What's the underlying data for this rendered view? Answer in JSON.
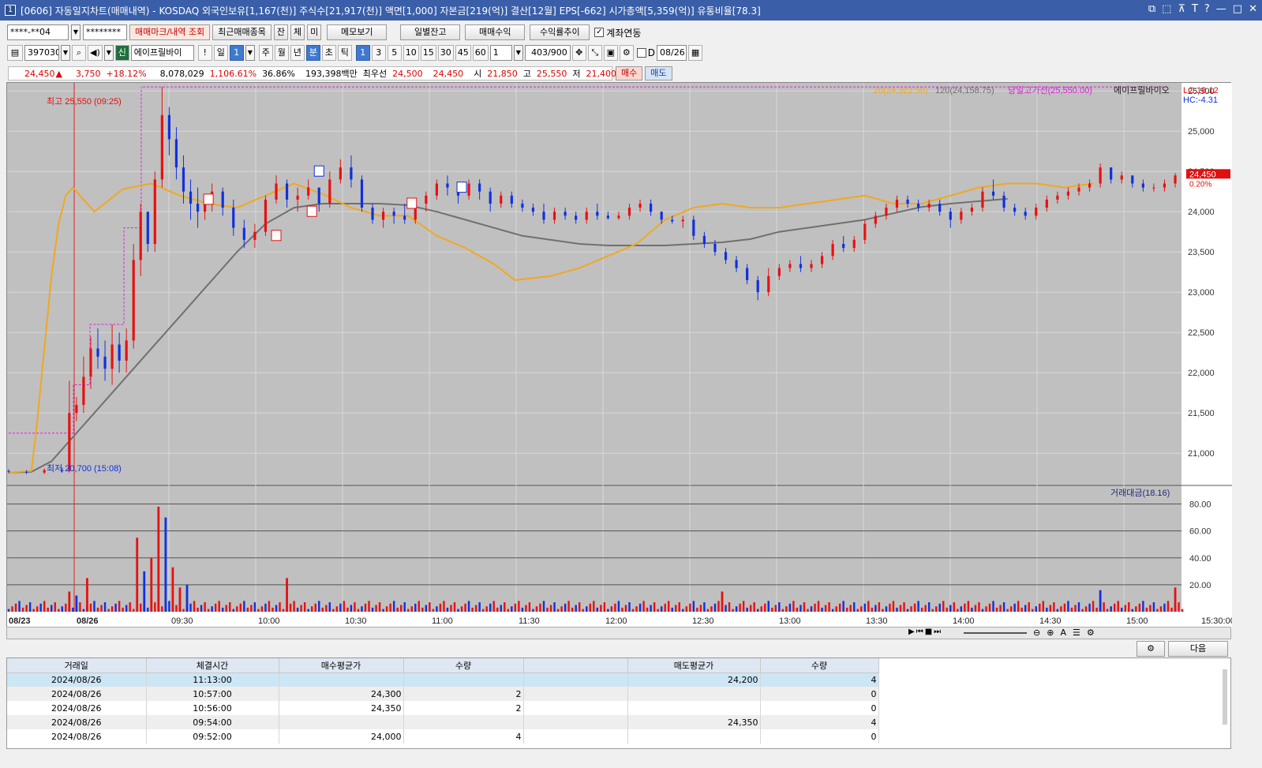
{
  "window": {
    "num": "1",
    "title": "[0606] 자동일지차트(매매내역) - KOSDAQ 외국인보유[1,167(천)] 주식수[21,917(천)] 액면[1,000] 자본금[219(억)] 결산[12월] EPS[-662] 시가총액[5,359(억)] 유통비율[78.3]",
    "controls": [
      "⧉",
      "⬚",
      "⊼",
      "T",
      "?",
      "—",
      "□",
      "✕"
    ]
  },
  "toolbar1": {
    "account": "****-**04",
    "password": "********",
    "mark_btn": "매매마크/내역 조회",
    "recent_btn": "최근매매종목",
    "tabs": [
      "잔",
      "체",
      "미"
    ],
    "memo_btn": "메모보기",
    "daily_btn": "일별잔고",
    "profit_btn": "매매수익",
    "rate_btn": "수익률추이",
    "link_label": "계좌연동",
    "link_checked": true
  },
  "toolbar2": {
    "code": "397030",
    "new_badge": "신",
    "stock_name": "에이프릴바이",
    "alert": "!",
    "period_day": "일",
    "period_num": "1",
    "periods": [
      "주",
      "월",
      "년",
      "분",
      "초",
      "틱"
    ],
    "period_selected": "분",
    "intervals": [
      "1",
      "3",
      "5",
      "10",
      "15",
      "30",
      "45",
      "60"
    ],
    "interval_selected": "1",
    "custom_interval": "1",
    "count": "403",
    "count_total": "/900",
    "d_label": "D",
    "date": "08/26"
  },
  "quote": {
    "price": "24,450",
    "arrow": "▲",
    "change": "3,750",
    "change_rate": "+18.12%",
    "volume": "8,078,029",
    "vol_rate": "1,106.61%",
    "turnover": "36.86%",
    "amount": "193,398백만",
    "best_label": "최우선",
    "ask": "24,500",
    "bid": "24,450",
    "open_label": "시",
    "open": "21,850",
    "high_label": "고",
    "high": "25,550",
    "low_label": "저",
    "low": "21,400",
    "buy_btn": "매수",
    "sell_btn": "매도"
  },
  "chart_data": {
    "type": "candlestick",
    "legend": {
      "ma20": "20(24,322.50)",
      "ma120": "120(24,158.75)",
      "highline": "당일고가선(25,550.00)",
      "name": "에이프릴바이오",
      "lc": "LC:18.12",
      "hc": "HC:-4.31"
    },
    "annotations": {
      "high": "최고 25,550 (09:25)",
      "low": "최저 20,700 (15:08)"
    },
    "current_price": "24,450",
    "current_rate": "0.20%",
    "price_ticks": [
      "25,500",
      "25,000",
      "24,500",
      "24,000",
      "23,500",
      "23,000",
      "22,500",
      "22,000",
      "21,500",
      "21,000"
    ],
    "price_tick_values": [
      25500,
      25000,
      24500,
      24000,
      23500,
      23000,
      22500,
      22000,
      21500,
      21000
    ],
    "volume_label": "거래대금(18.16)",
    "volume_ticks": [
      "80.00",
      "60.00",
      "40.00",
      "20.00"
    ],
    "volume_tick_values": [
      80,
      60,
      40,
      20
    ],
    "time_labels": [
      "08/23",
      "08/26",
      "09:30",
      "10:00",
      "10:30",
      "11:00",
      "11:30",
      "12:00",
      "12:30",
      "13:00",
      "13:30",
      "14:00",
      "14:30",
      "15:00",
      "15:30:00"
    ],
    "ma20_points": [
      [
        0,
        20760
      ],
      [
        16,
        20780
      ],
      [
        20,
        21400
      ],
      [
        25,
        22300
      ],
      [
        30,
        23200
      ],
      [
        35,
        23850
      ],
      [
        40,
        24200
      ],
      [
        45,
        24300
      ],
      [
        60,
        24000
      ],
      [
        80,
        24280
      ],
      [
        100,
        24350
      ],
      [
        120,
        24200
      ],
      [
        140,
        24100
      ],
      [
        160,
        24050
      ],
      [
        180,
        24200
      ],
      [
        200,
        24350
      ],
      [
        220,
        24220
      ],
      [
        240,
        24050
      ],
      [
        260,
        23950
      ],
      [
        280,
        23950
      ],
      [
        300,
        23700
      ],
      [
        320,
        23550
      ],
      [
        340,
        23350
      ],
      [
        355,
        23150
      ],
      [
        380,
        23200
      ],
      [
        400,
        23300
      ],
      [
        420,
        23450
      ],
      [
        440,
        23600
      ],
      [
        460,
        23900
      ],
      [
        480,
        24050
      ],
      [
        500,
        24100
      ],
      [
        520,
        24050
      ],
      [
        540,
        24050
      ],
      [
        560,
        24100
      ],
      [
        580,
        24150
      ],
      [
        600,
        24200
      ],
      [
        620,
        24100
      ],
      [
        640,
        24100
      ],
      [
        660,
        24200
      ],
      [
        680,
        24300
      ],
      [
        700,
        24350
      ],
      [
        720,
        24350
      ],
      [
        740,
        24300
      ],
      [
        760,
        24350
      ]
    ],
    "ma120_points": [
      [
        0,
        20760
      ],
      [
        16,
        20770
      ],
      [
        30,
        20900
      ],
      [
        40,
        21100
      ],
      [
        60,
        21500
      ],
      [
        80,
        21900
      ],
      [
        100,
        22300
      ],
      [
        120,
        22700
      ],
      [
        140,
        23100
      ],
      [
        160,
        23500
      ],
      [
        180,
        23850
      ],
      [
        200,
        24050
      ],
      [
        220,
        24100
      ],
      [
        240,
        24100
      ],
      [
        260,
        24100
      ],
      [
        280,
        24080
      ],
      [
        300,
        24000
      ],
      [
        320,
        23900
      ],
      [
        340,
        23800
      ],
      [
        360,
        23700
      ],
      [
        380,
        23650
      ],
      [
        400,
        23600
      ],
      [
        420,
        23580
      ],
      [
        440,
        23580
      ],
      [
        460,
        23580
      ],
      [
        480,
        23600
      ],
      [
        500,
        23620
      ],
      [
        520,
        23660
      ],
      [
        540,
        23750
      ],
      [
        560,
        23800
      ],
      [
        580,
        23850
      ],
      [
        600,
        23900
      ],
      [
        620,
        23980
      ],
      [
        640,
        24060
      ],
      [
        660,
        24100
      ],
      [
        680,
        24130
      ],
      [
        700,
        24160
      ]
    ],
    "candles": [
      [
        0,
        20780,
        20800,
        20750,
        20770
      ],
      [
        5,
        20770,
        20790,
        20740,
        20760
      ],
      [
        10,
        20760,
        20810,
        20740,
        20790
      ],
      [
        15,
        20790,
        20820,
        20760,
        20780
      ],
      [
        17,
        20780,
        21900,
        20760,
        21500
      ],
      [
        19,
        21500,
        21700,
        21400,
        21600
      ],
      [
        21,
        21600,
        22200,
        21500,
        21950
      ],
      [
        23,
        21950,
        22450,
        21800,
        22300
      ],
      [
        25,
        22300,
        22550,
        22050,
        22200
      ],
      [
        27,
        22200,
        22400,
        21900,
        22050
      ],
      [
        29,
        22050,
        22600,
        21850,
        22350
      ],
      [
        31,
        22350,
        22500,
        22000,
        22150
      ],
      [
        33,
        22150,
        22550,
        22000,
        22400
      ],
      [
        35,
        22400,
        23600,
        22300,
        23400
      ],
      [
        37,
        23400,
        24100,
        23200,
        24000
      ],
      [
        39,
        24000,
        23900,
        23500,
        23600
      ],
      [
        41,
        23600,
        24500,
        23500,
        24400
      ],
      [
        43,
        24400,
        25550,
        24300,
        25200
      ],
      [
        45,
        25200,
        25300,
        24700,
        24900
      ],
      [
        47,
        24900,
        25050,
        24400,
        24550
      ],
      [
        49,
        24550,
        24700,
        24100,
        24250
      ],
      [
        51,
        24250,
        24400,
        23900,
        24100
      ],
      [
        53,
        24100,
        24300,
        23800,
        24000
      ],
      [
        55,
        24000,
        24200,
        23900,
        24150
      ],
      [
        57,
        24150,
        24350,
        24000,
        24250
      ],
      [
        60,
        24250,
        24300,
        23950,
        24050
      ],
      [
        63,
        24050,
        24150,
        23700,
        23800
      ],
      [
        66,
        23800,
        23900,
        23550,
        23650
      ],
      [
        69,
        23650,
        23850,
        23550,
        23750
      ],
      [
        72,
        23750,
        24200,
        23700,
        24150
      ],
      [
        75,
        24150,
        24450,
        24100,
        24350
      ],
      [
        78,
        24350,
        24400,
        24050,
        24150
      ],
      [
        81,
        24150,
        24300,
        24000,
        24200
      ],
      [
        84,
        24200,
        24400,
        24150,
        24300
      ],
      [
        87,
        24300,
        24250,
        24000,
        24100
      ],
      [
        90,
        24100,
        24500,
        24050,
        24400
      ],
      [
        93,
        24400,
        24650,
        24350,
        24550
      ],
      [
        96,
        24550,
        24700,
        24300,
        24400
      ],
      [
        99,
        24400,
        24450,
        24000,
        24050
      ],
      [
        102,
        24050,
        24100,
        23850,
        23900
      ],
      [
        105,
        23900,
        24050,
        23800,
        24000
      ],
      [
        108,
        24000,
        24050,
        23850,
        23950
      ],
      [
        111,
        23950,
        24100,
        23850,
        23900
      ],
      [
        114,
        23900,
        24150,
        23850,
        24100
      ],
      [
        117,
        24100,
        24250,
        24000,
        24200
      ],
      [
        120,
        24200,
        24400,
        24150,
        24350
      ],
      [
        123,
        24350,
        24450,
        24200,
        24300
      ],
      [
        126,
        24300,
        24350,
        24100,
        24200
      ],
      [
        129,
        24200,
        24400,
        24150,
        24350
      ],
      [
        132,
        24350,
        24400,
        24150,
        24250
      ],
      [
        135,
        24250,
        24300,
        24000,
        24100
      ],
      [
        138,
        24100,
        24250,
        24050,
        24200
      ],
      [
        141,
        24200,
        24250,
        24050,
        24100
      ],
      [
        144,
        24100,
        24150,
        24000,
        24050
      ],
      [
        147,
        24050,
        24100,
        23950,
        24000
      ],
      [
        150,
        24000,
        24100,
        23850,
        23900
      ],
      [
        153,
        23900,
        24050,
        23850,
        24000
      ],
      [
        156,
        24000,
        24050,
        23900,
        23950
      ],
      [
        159,
        23950,
        24000,
        23850,
        23900
      ],
      [
        162,
        23900,
        24050,
        23850,
        24000
      ],
      [
        165,
        24000,
        24100,
        23900,
        23950
      ],
      [
        168,
        23950,
        24000,
        23900,
        23920
      ],
      [
        171,
        23920,
        24000,
        23900,
        23950
      ],
      [
        174,
        23950,
        24100,
        23900,
        24050
      ],
      [
        177,
        24050,
        24150,
        24000,
        24100
      ],
      [
        180,
        24100,
        24150,
        23950,
        24000
      ],
      [
        183,
        24000,
        24000,
        23850,
        23900
      ],
      [
        186,
        23900,
        23950,
        23850,
        23880
      ],
      [
        189,
        23880,
        23950,
        23800,
        23900
      ],
      [
        192,
        23900,
        23950,
        23650,
        23700
      ],
      [
        195,
        23700,
        23750,
        23550,
        23600
      ],
      [
        198,
        23600,
        23650,
        23450,
        23500
      ],
      [
        201,
        23500,
        23550,
        23350,
        23400
      ],
      [
        204,
        23400,
        23450,
        23250,
        23300
      ],
      [
        207,
        23300,
        23350,
        23100,
        23150
      ],
      [
        210,
        23150,
        23200,
        22900,
        23000
      ],
      [
        213,
        23000,
        23300,
        22950,
        23200
      ],
      [
        216,
        23200,
        23350,
        23150,
        23300
      ],
      [
        219,
        23300,
        23400,
        23250,
        23350
      ],
      [
        222,
        23350,
        23450,
        23250,
        23300
      ],
      [
        225,
        23300,
        23400,
        23250,
        23350
      ],
      [
        228,
        23350,
        23500,
        23300,
        23450
      ],
      [
        231,
        23450,
        23650,
        23400,
        23600
      ],
      [
        234,
        23600,
        23700,
        23500,
        23550
      ],
      [
        237,
        23550,
        23700,
        23500,
        23650
      ],
      [
        240,
        23650,
        23900,
        23600,
        23850
      ],
      [
        243,
        23850,
        24000,
        23800,
        23950
      ],
      [
        246,
        23950,
        24100,
        23900,
        24050
      ],
      [
        249,
        24050,
        24200,
        24000,
        24150
      ],
      [
        252,
        24150,
        24200,
        24050,
        24100
      ],
      [
        255,
        24100,
        24150,
        24000,
        24050
      ],
      [
        258,
        24050,
        24150,
        24000,
        24100
      ],
      [
        261,
        24100,
        24150,
        23950,
        24000
      ],
      [
        264,
        24000,
        24050,
        23800,
        23900
      ],
      [
        267,
        23900,
        24050,
        23850,
        24000
      ],
      [
        270,
        24000,
        24100,
        23950,
        24050
      ],
      [
        273,
        24050,
        24300,
        24000,
        24250
      ],
      [
        276,
        24250,
        24400,
        24150,
        24200
      ],
      [
        279,
        24200,
        24250,
        24000,
        24050
      ],
      [
        282,
        24050,
        24100,
        23950,
        24000
      ],
      [
        285,
        24000,
        24050,
        23900,
        23950
      ],
      [
        288,
        23950,
        24100,
        23900,
        24050
      ],
      [
        291,
        24050,
        24200,
        24000,
        24150
      ],
      [
        294,
        24150,
        24250,
        24100,
        24200
      ],
      [
        297,
        24200,
        24300,
        24150,
        24250
      ],
      [
        300,
        24250,
        24350,
        24200,
        24300
      ],
      [
        303,
        24300,
        24400,
        24250,
        24350
      ],
      [
        306,
        24350,
        24600,
        24300,
        24550
      ],
      [
        309,
        24550,
        24550,
        24350,
        24400
      ],
      [
        312,
        24400,
        24500,
        24350,
        24450
      ],
      [
        315,
        24450,
        24450,
        24300,
        24350
      ],
      [
        318,
        24350,
        24400,
        24250,
        24300
      ],
      [
        321,
        24300,
        24350,
        24250,
        24300
      ],
      [
        324,
        24300,
        24400,
        24250,
        24350
      ],
      [
        327,
        24350,
        24480,
        24300,
        24450
      ]
    ],
    "volumes_desc": "per-bar volume in trading amount units (tens); visible peaks near 09:20",
    "volume_peaks": [
      [
        17,
        15
      ],
      [
        19,
        12
      ],
      [
        22,
        25
      ],
      [
        36,
        55
      ],
      [
        38,
        30
      ],
      [
        40,
        40
      ],
      [
        42,
        78
      ],
      [
        44,
        70
      ],
      [
        46,
        33
      ],
      [
        48,
        18
      ],
      [
        50,
        20
      ],
      [
        78,
        25
      ],
      [
        200,
        15
      ],
      [
        306,
        16
      ],
      [
        327,
        18
      ]
    ]
  },
  "scroll_icons": [
    "▶",
    "⏮",
    "■",
    "⏭"
  ],
  "zoom_icons": [
    "⊖",
    "⊕",
    "A",
    "☰",
    "⚙"
  ],
  "next_btn": "다음",
  "table": {
    "headers": [
      "거래일",
      "체결시간",
      "매수평균가",
      "수량",
      "",
      "매도평균가",
      "수량"
    ],
    "rows": [
      [
        "2024/08/26",
        "11:13:00",
        "",
        "",
        "",
        "24,200",
        "4"
      ],
      [
        "2024/08/26",
        "10:57:00",
        "24,300",
        "2",
        "",
        "",
        "0"
      ],
      [
        "2024/08/26",
        "10:56:00",
        "24,350",
        "2",
        "",
        "",
        "0"
      ],
      [
        "2024/08/26",
        "09:54:00",
        "",
        "",
        "",
        "24,350",
        "4"
      ],
      [
        "2024/08/26",
        "09:52:00",
        "24,000",
        "4",
        "",
        "",
        "0"
      ]
    ]
  }
}
